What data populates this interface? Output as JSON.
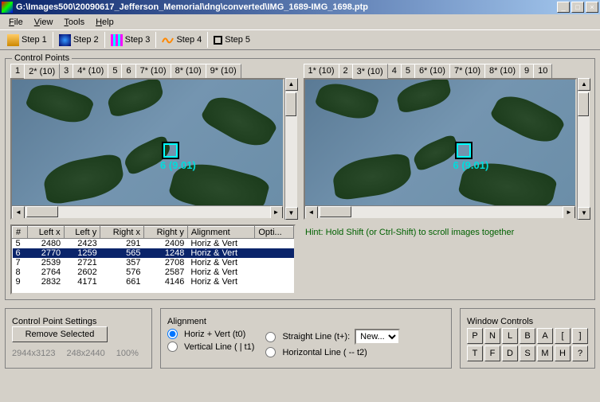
{
  "title": "G:\\Images500\\20090617_Jefferson_Memorial\\dng\\converted\\IMG_1689-IMG_1698.ptp",
  "menu": {
    "file": "File",
    "view": "View",
    "tools": "Tools",
    "help": "Help"
  },
  "steps": {
    "s1": "Step 1",
    "s2": "Step 2",
    "s3": "Step 3",
    "s4": "Step 4",
    "s5": "Step 5"
  },
  "cp_legend": "Control Points",
  "left_tabs": [
    "1",
    "2* (10)",
    "3",
    "4* (10)",
    "5",
    "6",
    "7* (10)",
    "8* (10)",
    "9* (10)"
  ],
  "left_active": 1,
  "right_tabs": [
    "1* (10)",
    "2",
    "3* (10)",
    "4",
    "5",
    "6* (10)",
    "7* (10)",
    "8* (10)",
    "9",
    "10"
  ],
  "right_active": 2,
  "target_label": "6 (9.01)",
  "table": {
    "headers": {
      "num": "#",
      "lx": "Left x",
      "ly": "Left y",
      "rx": "Right x",
      "ry": "Right y",
      "align": "Alignment",
      "opt": "Opti..."
    },
    "rows": [
      {
        "n": "5",
        "lx": "2480",
        "ly": "2423",
        "rx": "291",
        "ry": "2409",
        "a": "Horiz & Vert",
        "sel": false
      },
      {
        "n": "6",
        "lx": "2770",
        "ly": "1259",
        "rx": "565",
        "ry": "1248",
        "a": "Horiz & Vert",
        "sel": true
      },
      {
        "n": "7",
        "lx": "2539",
        "ly": "2721",
        "rx": "357",
        "ry": "2708",
        "a": "Horiz & Vert",
        "sel": false
      },
      {
        "n": "8",
        "lx": "2764",
        "ly": "2602",
        "rx": "576",
        "ry": "2587",
        "a": "Horiz & Vert",
        "sel": false
      },
      {
        "n": "9",
        "lx": "2832",
        "ly": "4171",
        "rx": "661",
        "ry": "4146",
        "a": "Horiz & Vert",
        "sel": false
      }
    ]
  },
  "hint": "Hint: Hold Shift (or Ctrl-Shift) to scroll images together",
  "settings": {
    "legend": "Control Point Settings",
    "remove": "Remove Selected",
    "dims1": "2944x3123",
    "dims2": "248x2440",
    "zoom": "100%"
  },
  "alignment": {
    "legend": "Alignment",
    "hv": "Horiz + Vert (t0)",
    "sl": "Straight Line (t+):",
    "vl": "Vertical Line ( | t1)",
    "hl": "Horizontal Line ( -- t2)",
    "new": "New..."
  },
  "window_controls": {
    "legend": "Window Controls",
    "row1": [
      "P",
      "N",
      "L",
      "B",
      "A",
      "[",
      "]"
    ],
    "row2": [
      "T",
      "F",
      "D",
      "S",
      "M",
      "H",
      "?"
    ]
  }
}
